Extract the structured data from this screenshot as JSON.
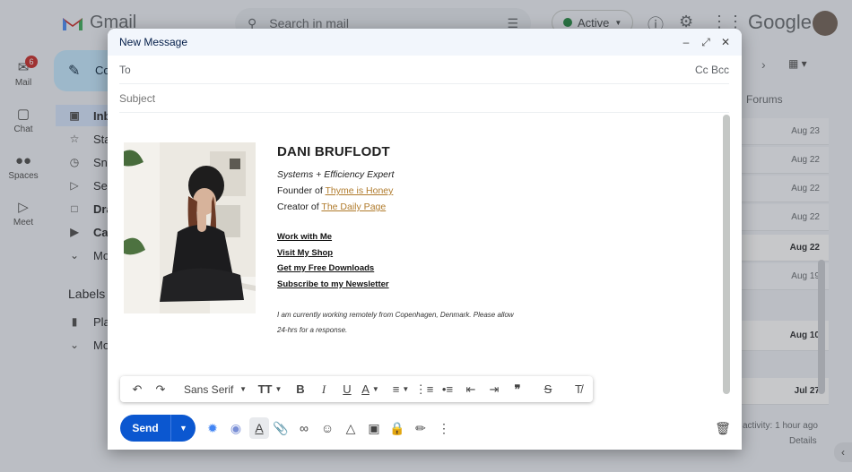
{
  "background": {
    "app_name": "Gmail",
    "search_placeholder": "Search in mail",
    "status": "Active",
    "brand_word": "Google",
    "rail": [
      {
        "label": "Mail",
        "badge": "6",
        "icon": "mail-icon"
      },
      {
        "label": "Chat",
        "icon": "chat-icon"
      },
      {
        "label": "Spaces",
        "icon": "spaces-icon"
      },
      {
        "label": "Meet",
        "icon": "meet-icon"
      }
    ],
    "compose_label": "Co",
    "nav": [
      "Inb",
      "Sta",
      "Sno",
      "Ser",
      "Dra",
      "Ca",
      "Mo"
    ],
    "labels_title": "Labels",
    "label_items": [
      "Pla",
      "Mo"
    ],
    "tab_forums": "Forums",
    "dates": [
      "Aug 23",
      "Aug 22",
      "Aug 22",
      "Aug 22",
      "Aug 22",
      "Aug 19",
      "Aug 10",
      "Jul 27"
    ],
    "activity": "activity: 1 hour ago",
    "details": "Details"
  },
  "compose": {
    "title": "New Message",
    "to_label": "To",
    "cc_bcc": "Cc Bcc",
    "subject_placeholder": "Subject",
    "signature": {
      "name": "DANI BRUFLODT",
      "tagline": "Systems + Efficiency Expert",
      "founder_prefix": "Founder of ",
      "founder_link": "Thyme is Honey",
      "creator_prefix": "Creator of ",
      "creator_link": "The Daily Page",
      "links": [
        "Work with Me",
        "Visit My Shop",
        "Get my Free Downloads",
        "Subscribe to my Newsletter"
      ],
      "note_line1": "I am currently working remotely from Copenhagen, Denmark. Please allow",
      "note_line2": "24-hrs for a response.",
      "link_color": "#b07b2c"
    },
    "toolbar": {
      "font": "Sans Serif"
    },
    "send_label": "Send",
    "accent": "#0b57d0"
  }
}
